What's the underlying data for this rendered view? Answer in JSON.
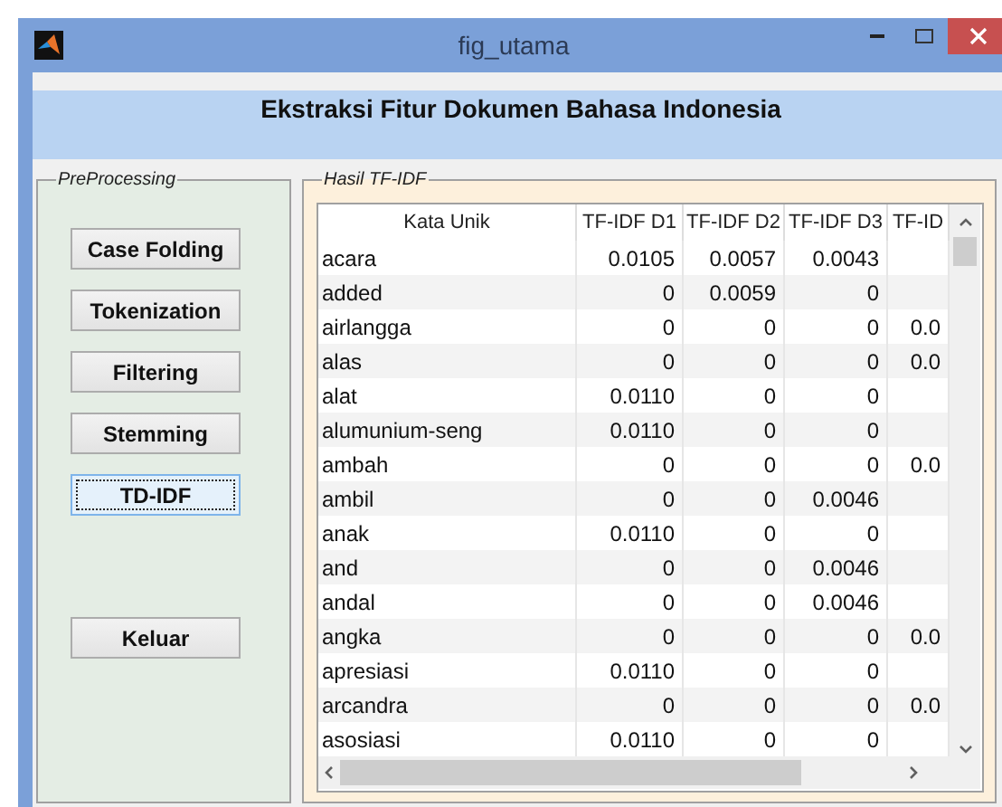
{
  "window": {
    "title": "fig_utama"
  },
  "header": {
    "title": "Ekstraksi Fitur Dokumen Bahasa Indonesia"
  },
  "preprocessing": {
    "title": "PreProcessing",
    "buttons": [
      {
        "label": "Case Folding",
        "focused": false
      },
      {
        "label": "Tokenization",
        "focused": false
      },
      {
        "label": "Filtering",
        "focused": false
      },
      {
        "label": "Stemming",
        "focused": false
      },
      {
        "label": "TD-IDF",
        "focused": true
      },
      {
        "label": "Keluar",
        "focused": false
      }
    ]
  },
  "results": {
    "title": "Hasil TF-IDF",
    "columns": [
      "Kata Unik",
      "TF-IDF D1",
      "TF-IDF D2",
      "TF-IDF D3",
      "TF-ID"
    ],
    "rows": [
      [
        "acara",
        "0.0105",
        "0.0057",
        "0.0043",
        ""
      ],
      [
        "added",
        "0",
        "0.0059",
        "0",
        ""
      ],
      [
        "airlangga",
        "0",
        "0",
        "0",
        "0.0"
      ],
      [
        "alas",
        "0",
        "0",
        "0",
        "0.0"
      ],
      [
        "alat",
        "0.0110",
        "0",
        "0",
        ""
      ],
      [
        "alumunium-seng",
        "0.0110",
        "0",
        "0",
        ""
      ],
      [
        "ambah",
        "0",
        "0",
        "0",
        "0.0"
      ],
      [
        "ambil",
        "0",
        "0",
        "0.0046",
        ""
      ],
      [
        "anak",
        "0.0110",
        "0",
        "0",
        ""
      ],
      [
        "and",
        "0",
        "0",
        "0.0046",
        ""
      ],
      [
        "andal",
        "0",
        "0",
        "0.0046",
        ""
      ],
      [
        "angka",
        "0",
        "0",
        "0",
        "0.0"
      ],
      [
        "apresiasi",
        "0.0110",
        "0",
        "0",
        ""
      ],
      [
        "arcandra",
        "0",
        "0",
        "0",
        "0.0"
      ],
      [
        "asosiasi",
        "0.0110",
        "0",
        "0",
        ""
      ]
    ]
  }
}
